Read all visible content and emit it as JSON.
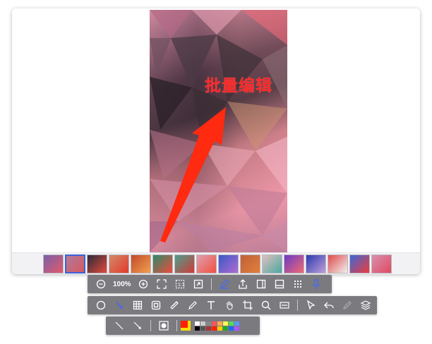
{
  "canvas": {
    "annotation_text": "批量编辑",
    "annotation_color": "#ff2a2a"
  },
  "filmstrip": {
    "thumbnail_count": 16,
    "selected_index": 1,
    "accent": "#3a62d8"
  },
  "toolbar_view": {
    "zoom_label": "100%",
    "tools": [
      "zoom-out-icon",
      "zoom-in-icon",
      "fit-screen-icon",
      "actual-size-icon",
      "export-frame-icon",
      "edit-signature-icon",
      "share-icon",
      "sidebar-icon",
      "panel-bottom-icon",
      "grid-icon",
      "pin-icon"
    ]
  },
  "toolbar_draw": {
    "tools": [
      "ellipse-icon",
      "arrow-icon",
      "mosaic-icon",
      "rectangle-icon",
      "ruler-icon",
      "pencil-icon",
      "text-icon",
      "hand-icon",
      "crop-icon",
      "magnifier-icon",
      "ocr-icon",
      "pointer-icon",
      "undo-icon",
      "redo-icon",
      "layers-icon"
    ]
  },
  "toolbar_style": {
    "tools": [
      "line-icon",
      "arrow-line-icon",
      "stroke-size-icon"
    ],
    "current_color": "#ff2200",
    "palette": [
      "#ffffff",
      "#cccccc",
      "#888888",
      "#ff5555",
      "#ffaa55",
      "#ffff55",
      "#55dd55",
      "#5599ff",
      "#000000",
      "#555555",
      "#aa3333",
      "#ff2200",
      "#ffcc00",
      "#22aa22",
      "#2266ff",
      "#aa55ff"
    ]
  }
}
